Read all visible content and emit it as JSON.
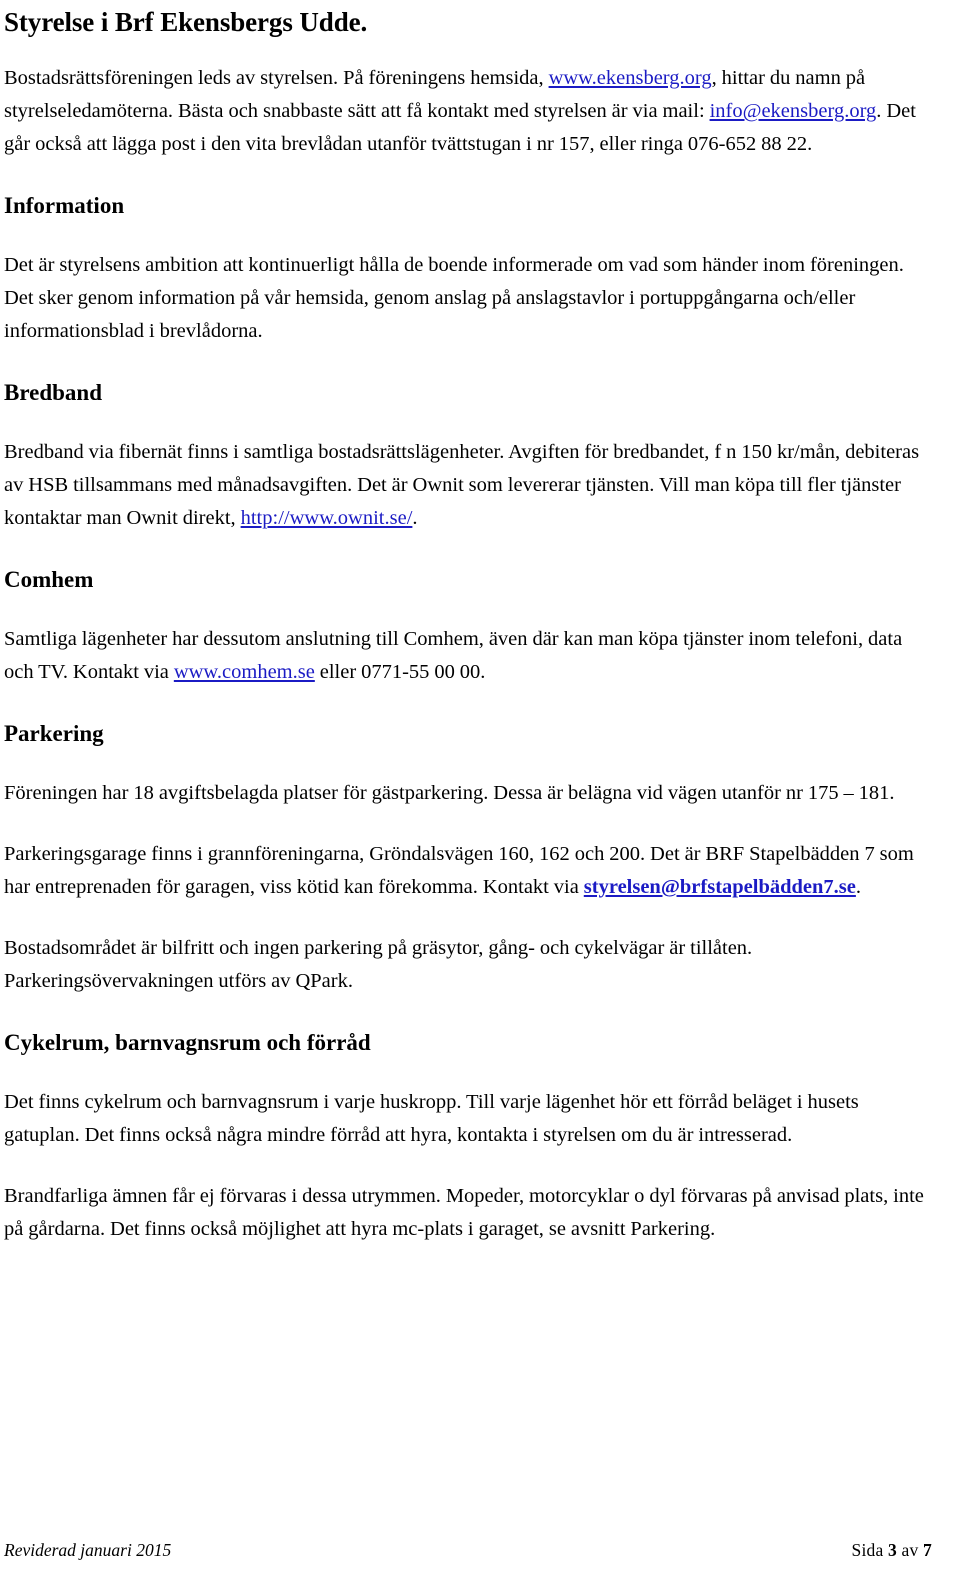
{
  "document": {
    "title": "Styrelse i Brf Ekensbergs Udde.",
    "intro": {
      "part1": "Bostadsrättsföreningen leds av styrelsen. På föreningens hemsida, ",
      "link_web": "www.ekensberg.org",
      "part2": ", hittar du namn på styrelseledamöterna. Bästa och snabbaste sätt att få kontakt med styrelsen är via mail: ",
      "link_mail": "info@ekensberg.org",
      "part3": ". Det går också att lägga post i den vita brevlådan utanför tvättstugan i nr 157, eller ringa 076-652 88 22."
    },
    "sections": [
      {
        "heading": "Information",
        "paragraphs": [
          "Det är styrelsens ambition att kontinuerligt hålla de boende informerade om vad som händer inom föreningen. Det sker genom information på vår hemsida, genom anslag på anslagstavlor i portuppgångarna och/eller informationsblad i brevlådorna."
        ]
      },
      {
        "heading": "Bredband",
        "bredband": {
          "part1": "Bredband via fibernät finns i samtliga bostadsrättslägenheter. Avgiften för bredbandet, f n 150 kr/mån, debiteras av HSB tillsammans med månadsavgiften. Det är Ownit som levererar tjänsten. Vill man köpa till fler tjänster kontaktar man Ownit direkt, ",
          "link": "http://www.ownit.se/",
          "part2": "."
        }
      },
      {
        "heading": "Comhem",
        "comhem": {
          "part1": "Samtliga lägenheter har dessutom anslutning till Comhem, även där kan man köpa tjänster inom telefoni, data och TV. Kontakt via ",
          "link": "www.comhem.se",
          "part2": " eller 0771-55 00 00."
        }
      },
      {
        "heading": "Parkering",
        "parkering": {
          "p1": "Föreningen har 18 avgiftsbelagda platser för gästparkering. Dessa är belägna vid vägen utanför nr 175 – 181.",
          "p2_part1": "Parkeringsgarage finns i grannföreningarna, Gröndalsvägen 160, 162 och 200. Det är BRF Stapelbädden 7 som har entreprenaden för garagen, viss kötid kan förekomma. Kontakt via ",
          "p2_link": "styrelsen@brfstapelbädden7.se",
          "p2_part2": ".",
          "p3": "Bostadsområdet är bilfritt och ingen parkering på gräsytor, gång- och cykelvägar är tillåten. Parkeringsövervakningen utförs av QPark."
        }
      },
      {
        "heading": "Cykelrum, barnvagnsrum och förråd",
        "paragraphs": [
          "Det finns cykelrum och barnvagnsrum i varje huskropp. Till varje lägenhet hör ett förråd beläget i husets gatuplan. Det finns också några mindre förråd att hyra, kontakta i styrelsen om du är intresserad.",
          "Brandfarliga ämnen får ej förvaras i dessa utrymmen. Mopeder, motorcyklar o dyl förvaras på anvisad plats, inte på gårdarna. Det finns också möjlighet att hyra mc-plats i garaget, se avsnitt Parkering."
        ]
      }
    ],
    "footer": {
      "revision": "Reviderad januari 2015",
      "page_label": "Sida",
      "page_number": "3",
      "page_of": "av",
      "page_total": "7"
    },
    "colors": {
      "link": "#1b1bc4",
      "text": "#000000",
      "background": "#ffffff"
    }
  }
}
